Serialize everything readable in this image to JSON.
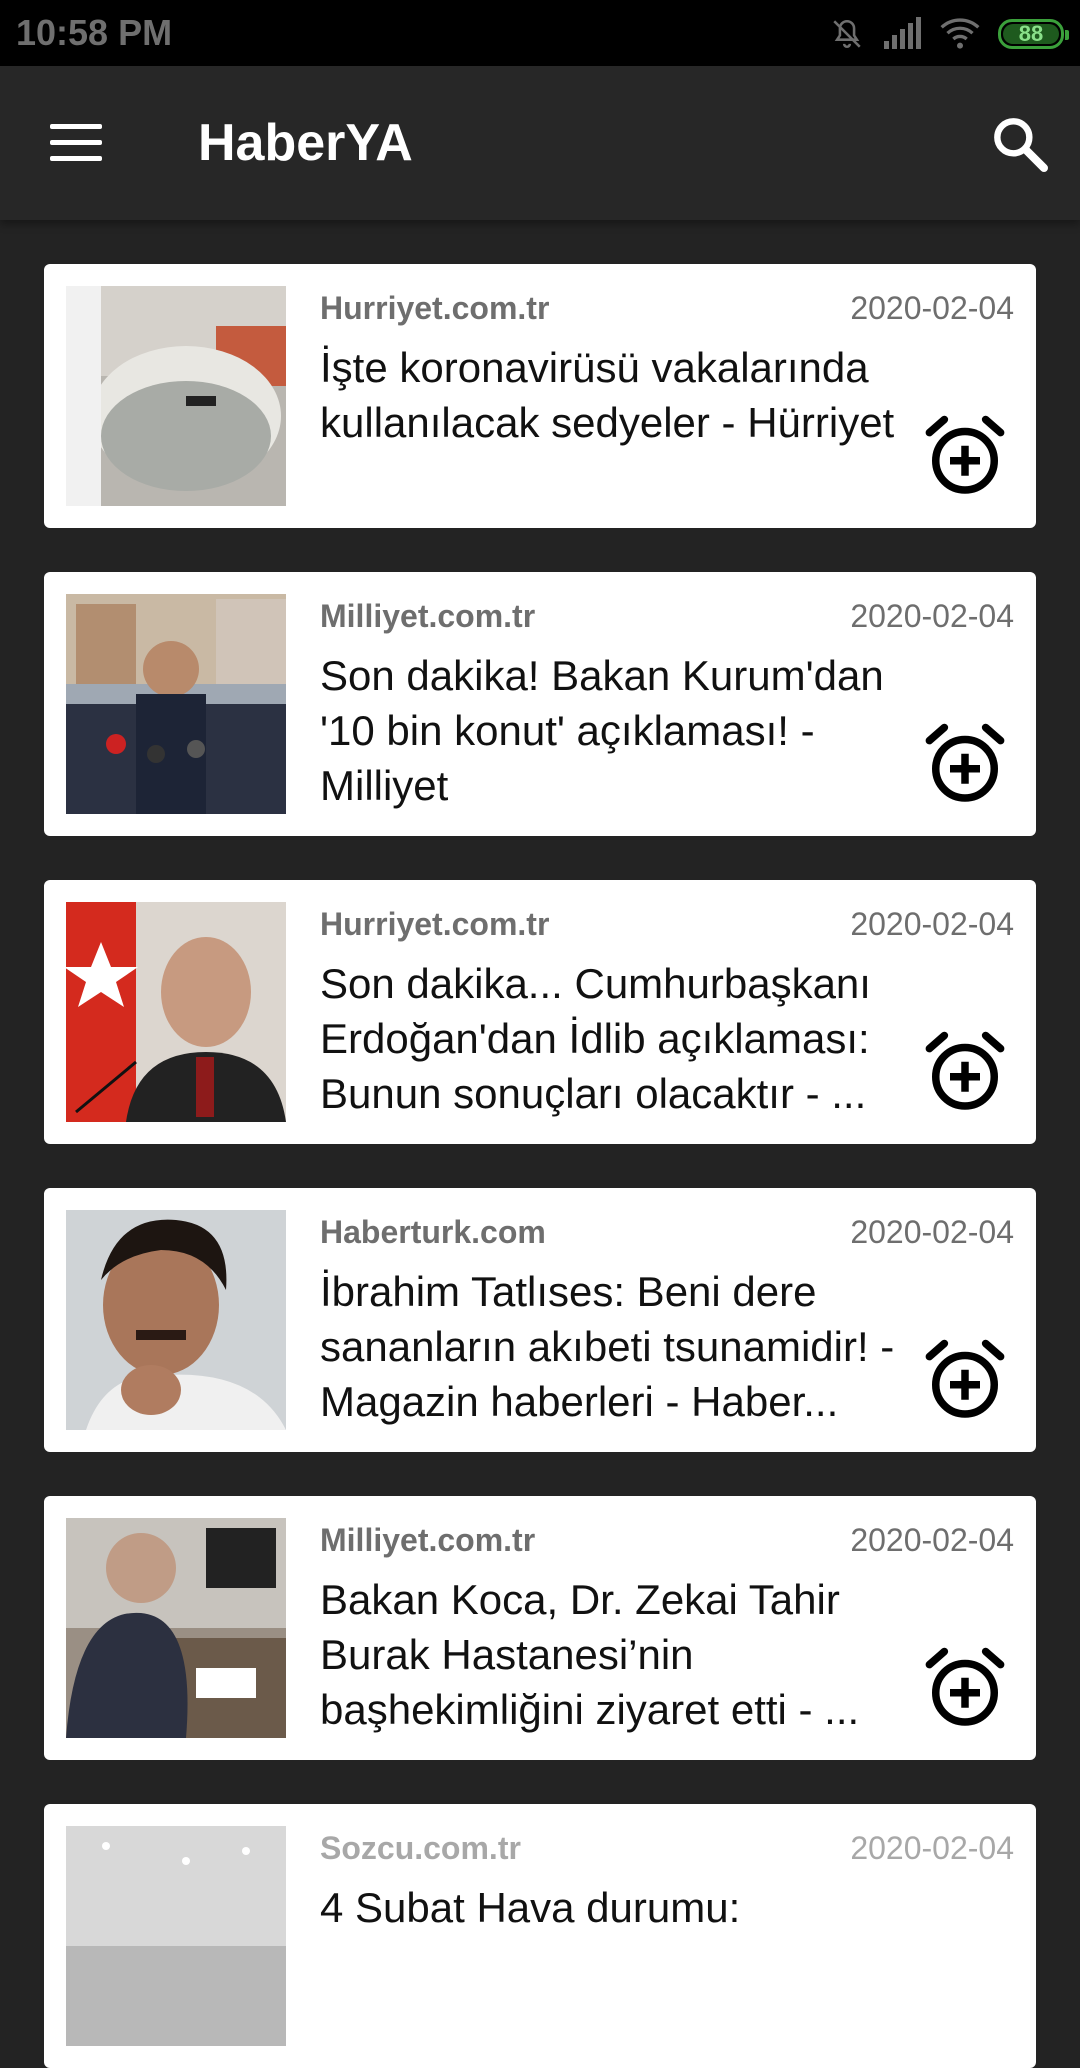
{
  "status_bar": {
    "time": "10:58 PM",
    "battery": "88",
    "icons": [
      "bell-off-icon",
      "signal-icon",
      "wifi-icon",
      "battery-icon"
    ]
  },
  "app_bar": {
    "title": "HaberYA",
    "menu_icon": "hamburger-menu-icon",
    "search_icon": "search-icon"
  },
  "colors": {
    "background": "#232323",
    "app_bar": "#272727",
    "card": "#ffffff",
    "source_text": "#6e6e6e"
  },
  "news": [
    {
      "source": "Hurriyet.com.tr",
      "date": "2020-02-04",
      "title": "İşte koronavirüsü vakalarında kullanılacak sedyeler - Hürriyet",
      "action_icon": "alarm-add-icon"
    },
    {
      "source": "Milliyet.com.tr",
      "date": "2020-02-04",
      "title": "Son dakika! Bakan Kurum'dan '10 bin konut' açıklaması! - Milliyet",
      "action_icon": "alarm-add-icon"
    },
    {
      "source": "Hurriyet.com.tr",
      "date": "2020-02-04",
      "title": "Son dakika... Cumhurbaşkanı Erdoğan'dan İdlib açıklaması: Bunun sonuçları olacaktır - ...",
      "action_icon": "alarm-add-icon"
    },
    {
      "source": "Haberturk.com",
      "date": "2020-02-04",
      "title": "İbrahim Tatlıses: Beni dere sananların akıbeti tsunamidir! - Magazin haberleri - Haber...",
      "action_icon": "alarm-add-icon"
    },
    {
      "source": "Milliyet.com.tr",
      "date": "2020-02-04",
      "title": "Bakan Koca, Dr. Zekai Tahir Burak Hastanesi’nin başhekimliğini ziyaret etti - ...",
      "action_icon": "alarm-add-icon"
    },
    {
      "source": "Sozcu.com.tr",
      "date": "2020-02-04",
      "title": "4 Subat Hava durumu:",
      "action_icon": "alarm-add-icon"
    }
  ]
}
